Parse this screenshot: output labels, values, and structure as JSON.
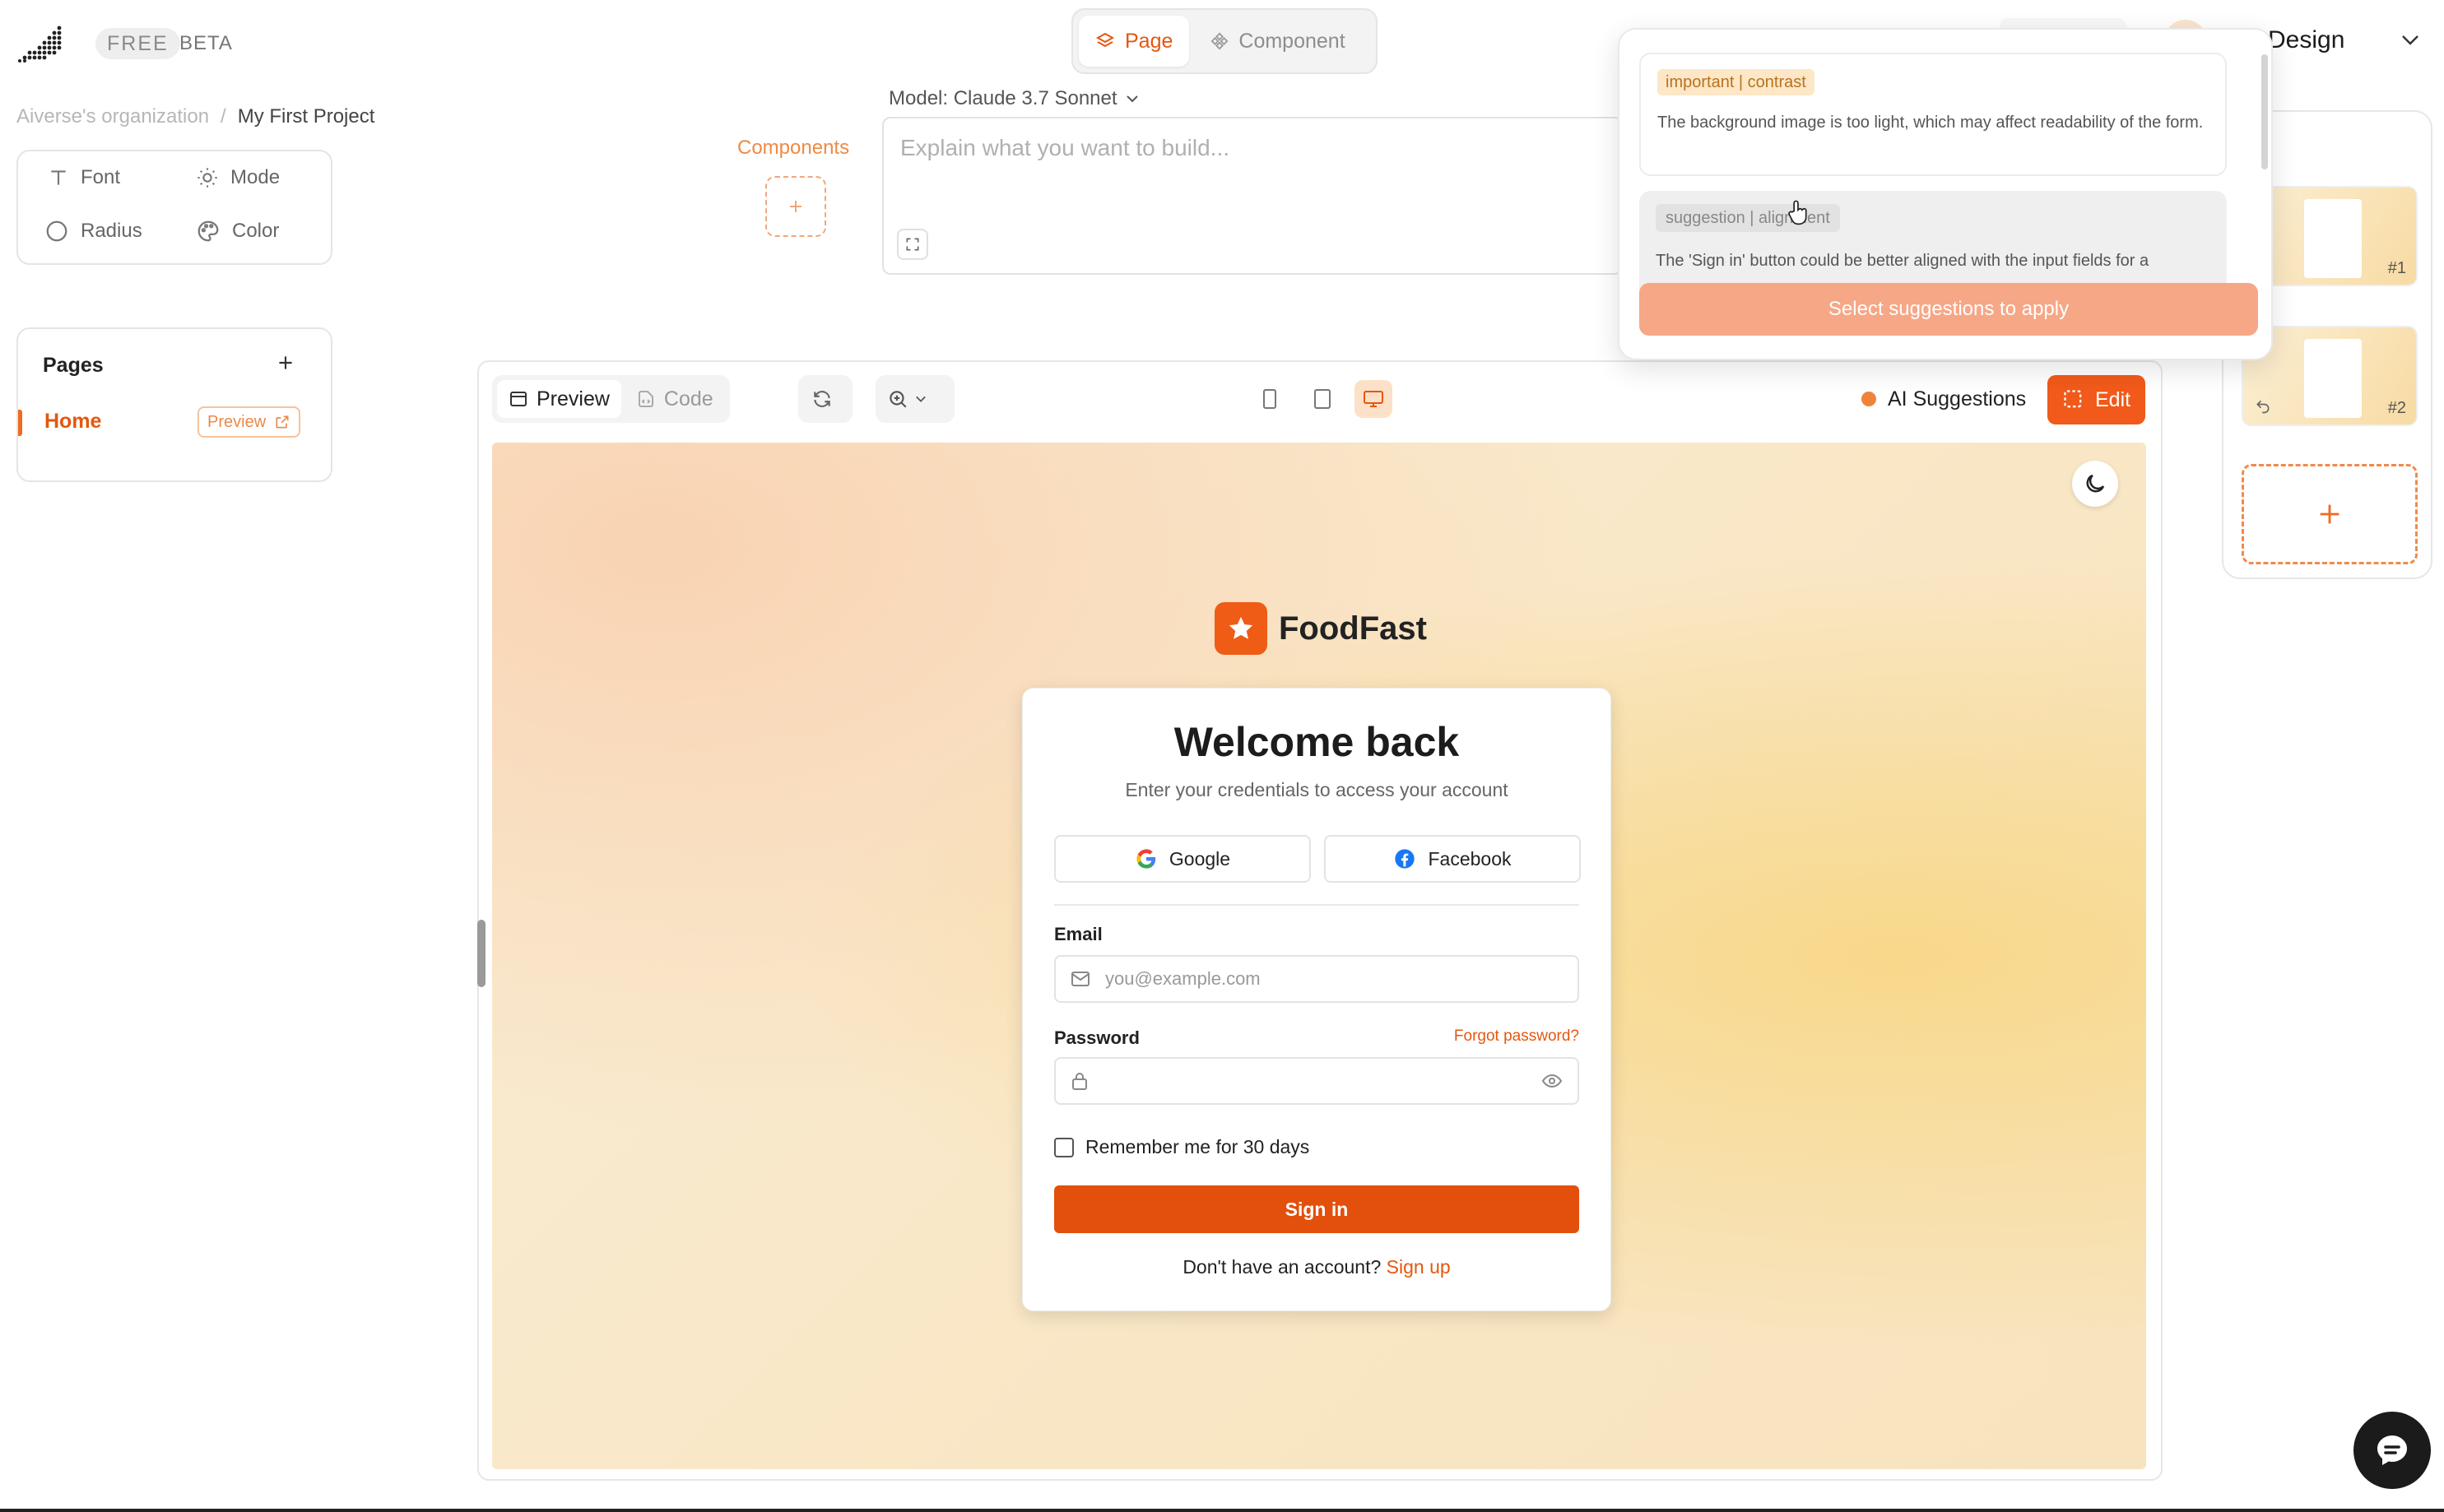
{
  "header": {
    "badge_free": "FREE",
    "badge_beta": "BETA",
    "mode_tabs": [
      {
        "label": "Page",
        "active": true
      },
      {
        "label": "Component",
        "active": false
      }
    ],
    "user_menu_label": "rse Design"
  },
  "breadcrumb": {
    "org": "Aiverse's organization",
    "separator": "/",
    "project": "My First Project"
  },
  "theme_panel": {
    "font": "Font",
    "mode": "Mode",
    "radius": "Radius",
    "color": "Color"
  },
  "pages_panel": {
    "title": "Pages",
    "items": [
      {
        "label": "Home",
        "preview_label": "Preview",
        "active": true
      }
    ]
  },
  "components": {
    "label": "Components"
  },
  "prompt": {
    "model_label": "Model: Claude 3.7 Sonnet",
    "placeholder": "Explain what you want to build..."
  },
  "suggestions_popup": {
    "items": [
      {
        "tag": "important | contrast",
        "text": "The background image is too light, which may affect readability of the form."
      },
      {
        "tag": "suggestion | alignment",
        "text": "The 'Sign in' button could be better aligned with the input fields for a"
      }
    ],
    "apply_label": "Select suggestions to apply"
  },
  "thumbnails": [
    {
      "label": "#1"
    },
    {
      "label": "#2"
    }
  ],
  "preview_toolbar": {
    "preview_tab": "Preview",
    "code_tab": "Code",
    "ai_suggestions_label": "AI Suggestions",
    "edit_label": "Edit"
  },
  "login_page": {
    "brand": "FoodFast",
    "title": "Welcome back",
    "subtitle": "Enter your credentials to access your account",
    "google": "Google",
    "facebook": "Facebook",
    "email_label": "Email",
    "email_placeholder": "you@example.com",
    "password_label": "Password",
    "forgot_label": "Forgot password?",
    "remember_label": "Remember me for 30 days",
    "signin_label": "Sign in",
    "signup_prompt": "Don't have an account?",
    "signup_link": "Sign up"
  },
  "colors": {
    "accent": "#e4570f",
    "accent_button": "#f15a1a",
    "suggestion_apply": "#f6a786"
  },
  "icons": [
    "logo-icon",
    "page-icon",
    "component-icon",
    "chevron-down-icon",
    "text-icon",
    "sun-icon",
    "circle-icon",
    "palette-icon",
    "plus-icon",
    "external-link-icon",
    "expand-icon",
    "cursor-icon",
    "preview-icon",
    "code-icon",
    "refresh-icon",
    "zoom-icon",
    "phone-icon",
    "tablet-icon",
    "desktop-icon",
    "edit-select-icon",
    "moon-icon",
    "star-icon",
    "google-icon",
    "facebook-icon",
    "mail-icon",
    "lock-icon",
    "eye-icon",
    "undo-icon",
    "chat-icon"
  ]
}
